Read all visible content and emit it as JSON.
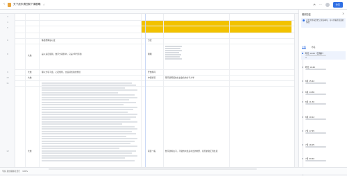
{
  "app": {
    "title": "天下战乐浦四前个课剧略",
    "share_label": "分享"
  },
  "icons": {
    "back": "chevron-left-icon",
    "doc": "spreadsheet-icon",
    "star": "star-icon",
    "more": "more-icon",
    "history": "clock-icon",
    "close": "close-icon"
  },
  "colors": {
    "accent": "#2f6fe4",
    "highlight": "#f2c200",
    "doc_icon": "#e8a33c"
  },
  "sheet": {
    "row_numbers": [
      "3",
      "4",
      "5",
      "6",
      "8",
      "9",
      "10",
      "11",
      "12"
    ],
    "cells": {
      "r6_b": "株选整理后以证",
      "r6_e": "分层",
      "r8_a": "大类",
      "r8_b": "是以多层级别，数字分期影响，只是7年代专题",
      "r8_e": "刚刚",
      "r9_a": "大类",
      "r9_b": "理以分项习会，心层规则，交运领划新的规划",
      "r9_e": "开始科同",
      "r10_a": "大类",
      "r10_e": "中铺状况",
      "r10_f": "理序说明报告社会会化的分享大学",
      "r12_a": "大类",
      "r12_e": "项目一般",
      "r12_f": "数字建筑在习，不做的共性后补出的效果，按照的融汇到处展"
    }
  },
  "panel": {
    "title": "保存历史",
    "note": "点击并查看历史记录版本时，可以查看原页面的情况",
    "tabs": [
      "全部",
      "命名"
    ],
    "versions": [
      {
        "label": "昨天 11:05（已保存）"
      },
      {
        "label": "昨天 10:40"
      },
      {
        "label": "8月 15:22"
      },
      {
        "label": "8月 14:56"
      },
      {
        "label": "8月 11:30"
      },
      {
        "label": "8月 10:12"
      },
      {
        "label": "7月 17:45"
      },
      {
        "label": "7月 16:05"
      },
      {
        "label": "7月 09:40"
      }
    ]
  },
  "bottom": {
    "sheet_tab": "专家·直线思路与活门",
    "zoom": "100%"
  }
}
